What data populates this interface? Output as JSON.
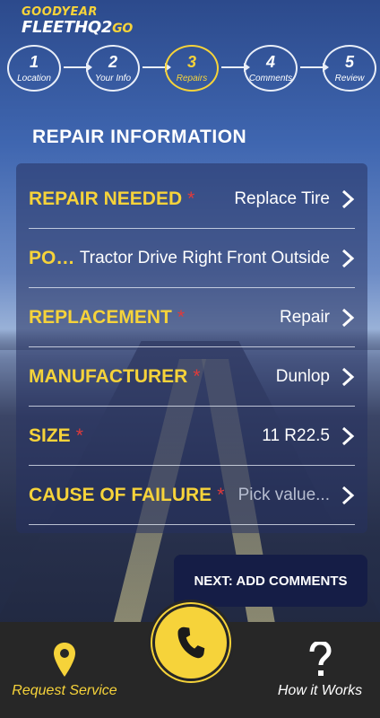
{
  "header": {
    "brand": "GOODYEAR",
    "app_name": "FLEETHQ2",
    "app_name_suffix": "GO"
  },
  "steps": [
    {
      "num": "1",
      "label": "Location",
      "active": false
    },
    {
      "num": "2",
      "label": "Your Info",
      "active": false
    },
    {
      "num": "3",
      "label": "Repairs",
      "active": true
    },
    {
      "num": "4",
      "label": "Comments",
      "active": false
    },
    {
      "num": "5",
      "label": "Review",
      "active": false
    }
  ],
  "section_title": "REPAIR INFORMATION",
  "fields": [
    {
      "label": "REPAIR NEEDED",
      "required": "*",
      "value": "Replace Tire"
    },
    {
      "label": "PO…",
      "required": "",
      "value": "Tractor Drive Right Front Outside"
    },
    {
      "label": "REPLACEMENT",
      "required": "*",
      "value": "Repair"
    },
    {
      "label": "MANUFACTURER",
      "required": "*",
      "value": "Dunlop"
    },
    {
      "label": "SIZE",
      "required": "*",
      "value": "11 R22.5"
    },
    {
      "label": "CAUSE OF FAILURE",
      "required": "*",
      "value": "Pick value..."
    }
  ],
  "next_button": "NEXT: ADD COMMENTS",
  "bottom_nav": {
    "request_service": "Request Service",
    "how_it_works": "How it Works"
  },
  "colors": {
    "accent": "#f6d33a",
    "required": "#e03a3a",
    "bottom_bar": "#272727",
    "button": "#151d46"
  },
  "icons": {
    "request_service": "location-pin-icon",
    "call": "phone-icon",
    "how_it_works": "question-mark-icon",
    "row_chevron": "chevron-right-icon"
  }
}
